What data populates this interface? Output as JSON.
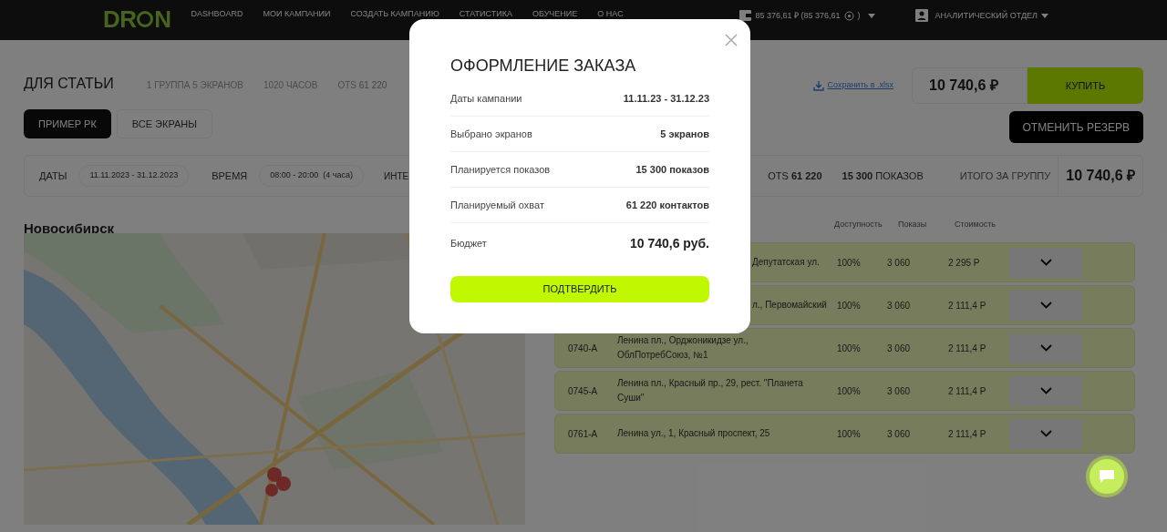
{
  "header": {
    "logo": "DR",
    "logo_tail": "N",
    "nav": [
      {
        "label": "DASHBOARD"
      },
      {
        "label": "МОИ КАМПАНИИ"
      },
      {
        "label": "СОЗДАТЬ КАМПАНИЮ"
      },
      {
        "label": "СТАТИСТИКА"
      },
      {
        "label": "ОБУЧЕНИЕ"
      },
      {
        "label": "О НАС"
      }
    ],
    "balance": "85 376,61 ₽ (85 376,61",
    "balance_close": ")",
    "account": "АНАЛИТИЧЕСКИЙ ОТДЕЛ"
  },
  "campaign": {
    "title": "ДЛЯ СТАТЬИ",
    "stats": [
      "1 ГРУППА 5 ЭКРАНОВ",
      "1020 ЧАСОВ"
    ],
    "ots_label": "OTS",
    "ots_value": "61 220",
    "save_link": "Сохранить в .xlsx",
    "total": "10 740,6 ₽",
    "buy": "КУПИТЬ",
    "cancel_reserve": "ОТМЕНИТЬ РЕЗЕРВ"
  },
  "tabs": [
    {
      "label": "ПРИМЕР РК",
      "selected": true
    },
    {
      "label": "ВСЕ ЭКРАНЫ",
      "selected": false
    }
  ],
  "filters": {
    "dates_label": "ДАТЫ",
    "dates": "11.11.2023 - 31.12.2023",
    "time_label": "ВРЕМЯ",
    "time": "08:00 - 20:00  (4 часа)",
    "cut_label": "ИНТЕ",
    "ots_label": "OTS",
    "ots_value": "61 220",
    "shows_value": "15 300",
    "shows_label": "ПОКАЗОВ",
    "group_total_label": "ИТОГО ЗА ГРУППУ",
    "group_total": "10 740,6 ₽"
  },
  "city": "Новосибирск",
  "table": {
    "columns": [
      "Доступность",
      "Показы",
      "Стоимость"
    ],
    "rows": [
      {
        "code": "",
        "address": "Депутатская ул.",
        "covered": true,
        "availability": "100%",
        "shows": "3 060",
        "cost": "2 295 Р"
      },
      {
        "code": "",
        "address": "л., Первомайский",
        "covered": true,
        "availability": "100%",
        "shows": "3 060",
        "cost": "2 111,4 Р"
      },
      {
        "code": "0740-А",
        "address": "Ленина пл., Орджоникидзе ул., ОблПотребСоюз, №1",
        "covered": false,
        "availability": "100%",
        "shows": "3 060",
        "cost": "2 111,4 Р"
      },
      {
        "code": "0745-А",
        "address": "Ленина пл., Красный пр., 29, рест. \"Планета Суши\"",
        "covered": false,
        "availability": "100%",
        "shows": "3 060",
        "cost": "2 111,4 Р"
      },
      {
        "code": "0761-А",
        "address": "Ленина ул., 1, Красный проспект, 25",
        "covered": false,
        "availability": "100%",
        "shows": "3 060",
        "cost": "2 111,4 Р"
      }
    ]
  },
  "modal": {
    "title": "ОФОРМЛЕНИЕ ЗАКАЗА",
    "rows": [
      {
        "label": "Даты кампании",
        "value": "11.11.23 - 31.12.23",
        "kind": "normal"
      },
      {
        "label": "Выбрано экранов",
        "value": "5 экранов",
        "kind": "normal"
      },
      {
        "label": "Планируется показов",
        "value": "15 300 показов",
        "kind": "normal"
      },
      {
        "label": "Планируемый охват",
        "value": "61 220 контактов",
        "kind": "normal"
      },
      {
        "label": "Бюджет",
        "value": "10 740,6 руб.",
        "kind": "total"
      }
    ],
    "confirm": "ПОДТВЕРДИТЬ"
  }
}
